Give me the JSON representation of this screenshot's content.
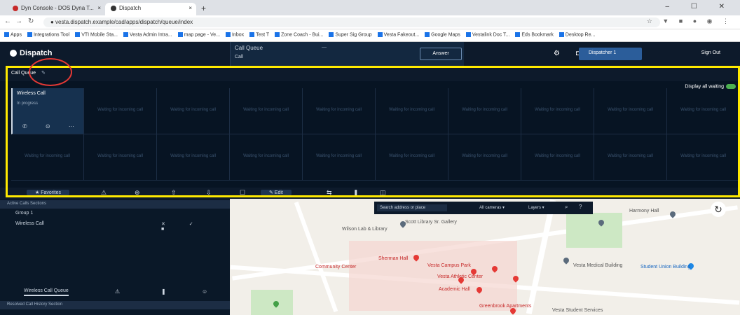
{
  "browser": {
    "tabs": [
      {
        "label": "Dyn Console - DOS Dyna T..."
      },
      {
        "label": "Dispatch"
      }
    ],
    "new_tab": "+",
    "window_controls": "–  ☐  ✕",
    "url": "● vesta.dispatch.example/cad/apps/dispatch/queue/index",
    "extensions": "☆ ▼ ■ ● ◉ ⋮",
    "bookmarks": [
      "Apps",
      "Integrations Tool",
      "VTI Mobile Sta...",
      "Vesta Admin Intra...",
      "map page - Ve...",
      "Inbox",
      "Test T",
      "Zone Coach - Bui...",
      "Super Sig Group",
      "Vesta Fakeout...",
      "Google Maps",
      "Vestalink Doc T...",
      "Eds Bookmark",
      "Desktop Re..."
    ]
  },
  "app": {
    "logo": "Dispatch",
    "call_block": {
      "label": "Call Queue",
      "sub": "Call",
      "mid": "—",
      "answer": "Answer"
    },
    "header_icons": "⚙ ◘",
    "user": "Dispatcher 1",
    "signout": "Sign Out"
  },
  "queue_bar": {
    "label": "Call Queue",
    "edit_icon": "✎"
  },
  "pane": {
    "toggle_label": "Display all waiting",
    "active_call": {
      "name": "Wireless Call",
      "status": "In progress",
      "icons": "✆ ⊙ ⋯"
    },
    "empty_cell": "Waiting for incoming call"
  },
  "toolbar": {
    "favorites": "★ Favorites",
    "i1": "⚠",
    "i2": "⊕",
    "i3": "⇧",
    "i4": "⇩",
    "i5": "☐",
    "edit": "✎ Edit",
    "i6": "⇆",
    "i7": "❚",
    "i8": "◫"
  },
  "left": {
    "sec1": "Active Calls Sections",
    "group": "Group 1",
    "call_row": "Wireless Call",
    "row_icons": "✕ ✓ ■",
    "tabs": [
      "Wireless Call Queue",
      "⚠",
      "❚",
      "☺"
    ],
    "sec2": "Resolved Call History Section"
  },
  "map": {
    "search_placeholder": "Search address or place",
    "dd1": "All cameras ▾",
    "dd2": "Layers ▾",
    "labels": [
      "Wilson Lab & Library",
      "Scott Library Sr. Gallery",
      "Sherman Hall",
      "Vesta Campus Park",
      "Community Center",
      "Vesta Athletic Center",
      "Academic Hall",
      "Vesta Medical Building",
      "Student Union Building",
      "Harmony Hall",
      "Vesta Student Services",
      "Greenbrook Apartments"
    ],
    "reload": "↻"
  }
}
